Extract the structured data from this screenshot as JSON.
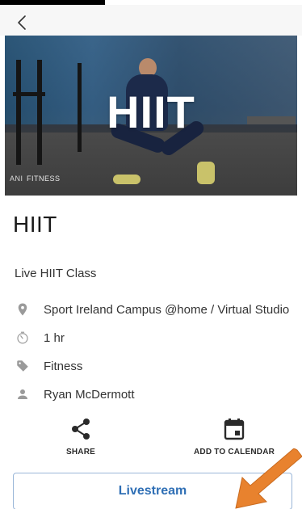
{
  "header": {
    "back_icon": "chevron-left-icon"
  },
  "hero": {
    "overlay_title": "HIIT",
    "caption_prefix": "ANI",
    "caption": "FITNESS"
  },
  "event": {
    "title": "HIIT",
    "subtitle": "Live HIIT Class",
    "details": [
      {
        "icon": "location-pin-icon",
        "text": "Sport Ireland Campus @home / Virtual Studio"
      },
      {
        "icon": "timer-icon",
        "text": "1 hr"
      },
      {
        "icon": "tag-icon",
        "text": "Fitness"
      },
      {
        "icon": "person-icon",
        "text": "Ryan McDermott"
      }
    ]
  },
  "actions": {
    "share_label": "SHARE",
    "calendar_label": "ADD TO CALENDAR"
  },
  "cta": {
    "label": "Livestream"
  },
  "colors": {
    "accent_blue": "#2f6fb5",
    "icon_gray": "#9a9a9a",
    "annotation_arrow": "#e8822e"
  }
}
